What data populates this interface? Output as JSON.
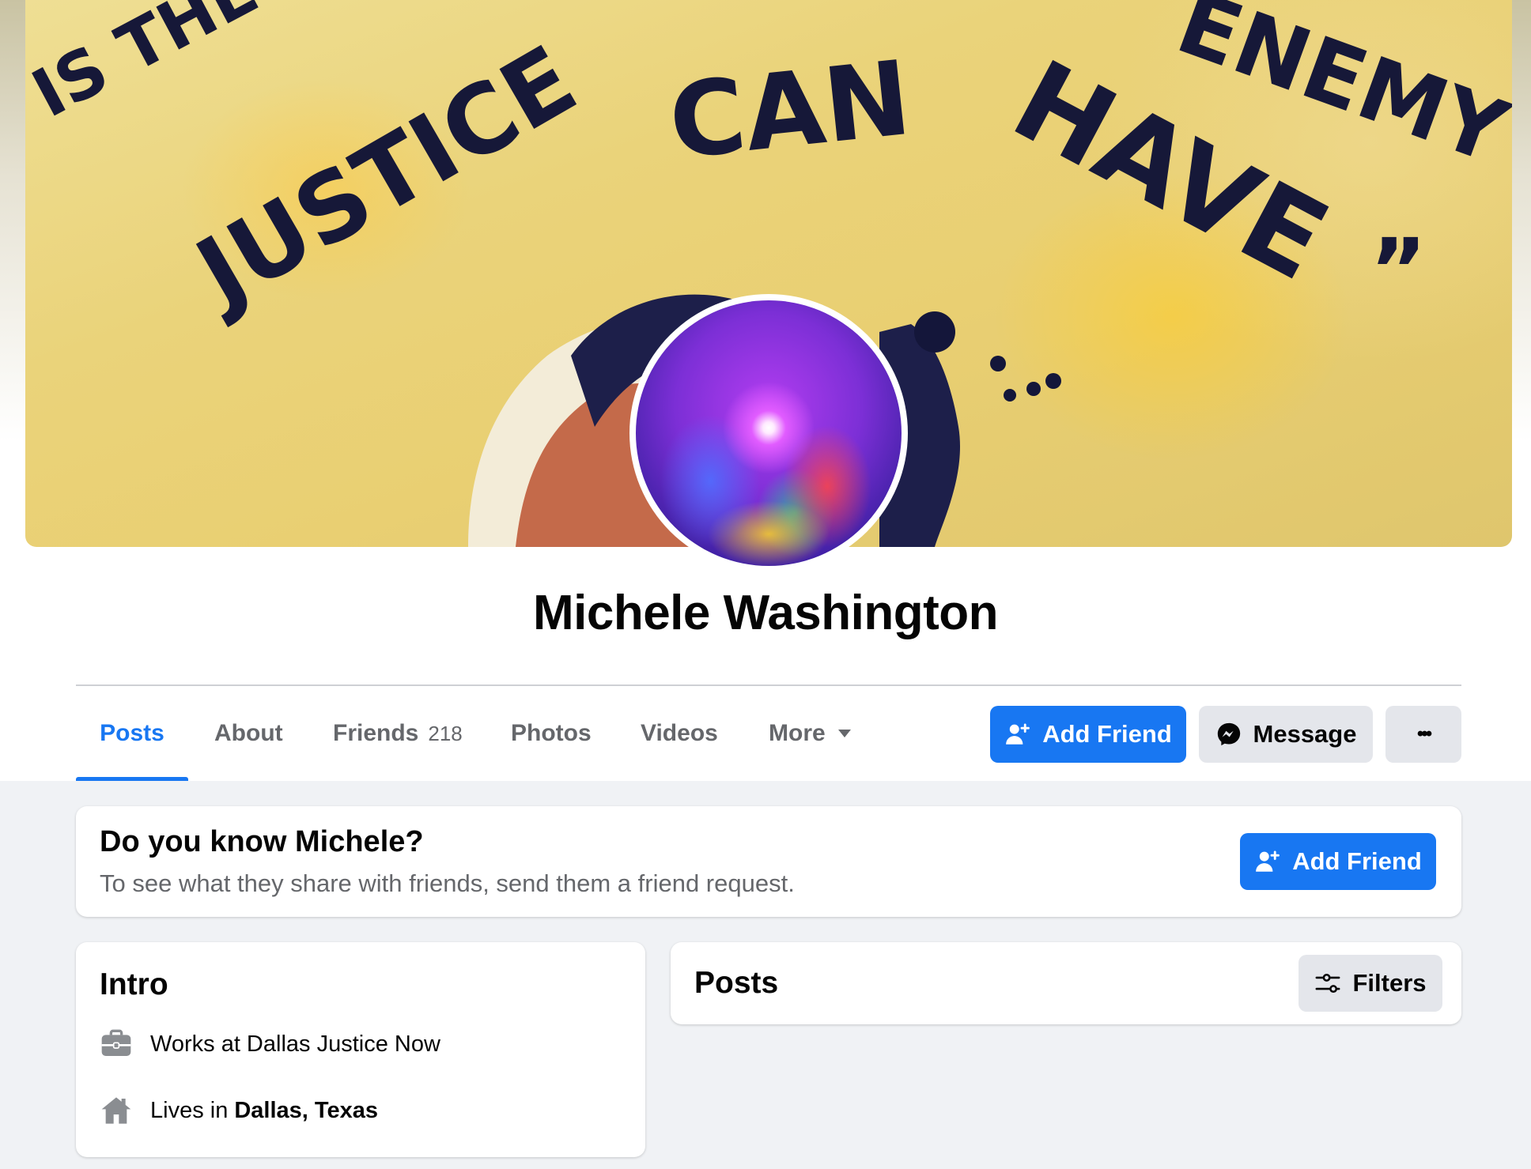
{
  "profile": {
    "name": "Michele Washington"
  },
  "cover_text": {
    "line1": "IS THE MOST",
    "line1b": "ENEMY",
    "line2a": "JUSTICE",
    "line2b": "CAN",
    "line2c": "HAVE",
    "quote_mark": "”"
  },
  "tabs": [
    {
      "label": "Posts",
      "active": true
    },
    {
      "label": "About"
    },
    {
      "label": "Friends",
      "count": "218"
    },
    {
      "label": "Photos"
    },
    {
      "label": "Videos"
    },
    {
      "label": "More"
    }
  ],
  "actions": {
    "add_friend": "Add Friend",
    "message": "Message",
    "more": "•••"
  },
  "know_card": {
    "title": "Do you know Michele?",
    "subtitle": "To see what they share with friends, send them a friend request.",
    "button": "Add Friend"
  },
  "intro": {
    "title": "Intro",
    "work_prefix": "Works at Dallas Justice Now",
    "lives_prefix": "Lives in",
    "lives_place": "Dallas, Texas"
  },
  "posts_card": {
    "title": "Posts",
    "filters": "Filters"
  },
  "icons": {
    "add_friend": "user-plus-icon",
    "message": "messenger-icon",
    "work": "briefcase-icon",
    "home": "home-icon",
    "filters": "sliders-icon",
    "more": "caret-down-icon"
  },
  "colors": {
    "accent": "#1877f2",
    "secondary_bg": "#e4e6eb",
    "page_bg": "#f0f2f5",
    "muted_text": "#65676b"
  }
}
